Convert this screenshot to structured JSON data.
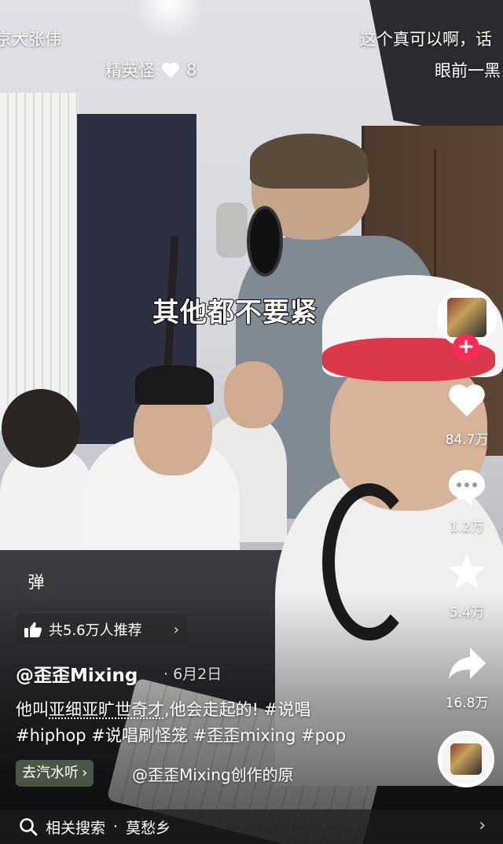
{
  "danmaku": {
    "top_left": "京大张伟",
    "top_right": "这个真可以啊，话",
    "row2_left_text": "精英怪",
    "row2_left_likes": "8",
    "row2_right": "眼前一黑"
  },
  "video_caption": "其他都不要紧",
  "actions": {
    "likes": "84.7万",
    "comments": "1.2万",
    "favorites": "5.4万",
    "shares": "16.8万",
    "follow_symbol": "+"
  },
  "danmu_toggle": "弹",
  "recommend": {
    "text": "共5.6万人推荐",
    "chevron": "›"
  },
  "post": {
    "author": "@歪歪Mixing",
    "date": "· 6月2日",
    "desc_line1_part1": "他叫",
    "desc_line1_link": "亚细亚旷世奇才",
    "desc_line1_part2": ",他会走起的! #说唱",
    "desc_line2": "#hiphop #说唱刷怪笼 #歪歪mixing #pop"
  },
  "tag": {
    "label": "去汽水听",
    "chevron": "›"
  },
  "music": {
    "text": "@歪歪Mixing创作的原"
  },
  "search": {
    "label": "相关搜索",
    "separator": "·",
    "query": "莫愁乡",
    "chevron": "›"
  }
}
